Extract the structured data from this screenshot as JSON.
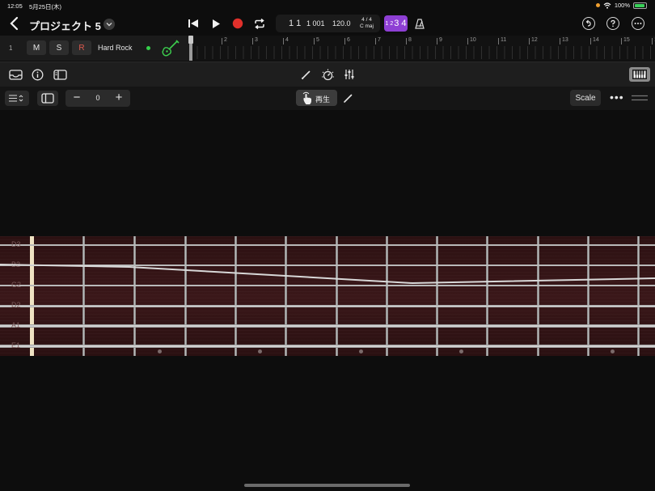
{
  "status": {
    "time": "12:05",
    "date": "5月25日(木)",
    "battery": "100%"
  },
  "header": {
    "project_title": "プロジェクト 5",
    "transport": {
      "position_bar": "1 1",
      "position_beat": "1 001",
      "tempo": "120.0",
      "time_signature": "4 / 4",
      "key": "C maj",
      "count_in_small": "1 2",
      "count_in_big": "3 4"
    }
  },
  "track": {
    "number": "1",
    "mute_label": "M",
    "solo_label": "S",
    "record_label": "R",
    "name": "Hard Rock",
    "ruler_labels": [
      "2",
      "3",
      "4",
      "5",
      "6",
      "7",
      "8",
      "9",
      "10",
      "11",
      "12",
      "13",
      "14",
      "15",
      "16"
    ]
  },
  "editor": {
    "octave_value": "0",
    "minus_label": "−",
    "plus_label": "+",
    "play_mode_label": "再生",
    "scale_label": "Scale",
    "more_label": "•••"
  },
  "fretboard": {
    "strings": [
      "D3",
      "B2",
      "G2",
      "D2",
      "A1",
      "E1"
    ]
  },
  "colors": {
    "record": "#e0302b",
    "count_in": "#8e3fd4",
    "instrument_icon": "#3ccf4e",
    "track_led": "#35d04a",
    "fretboard_wood": "#3a1719"
  }
}
